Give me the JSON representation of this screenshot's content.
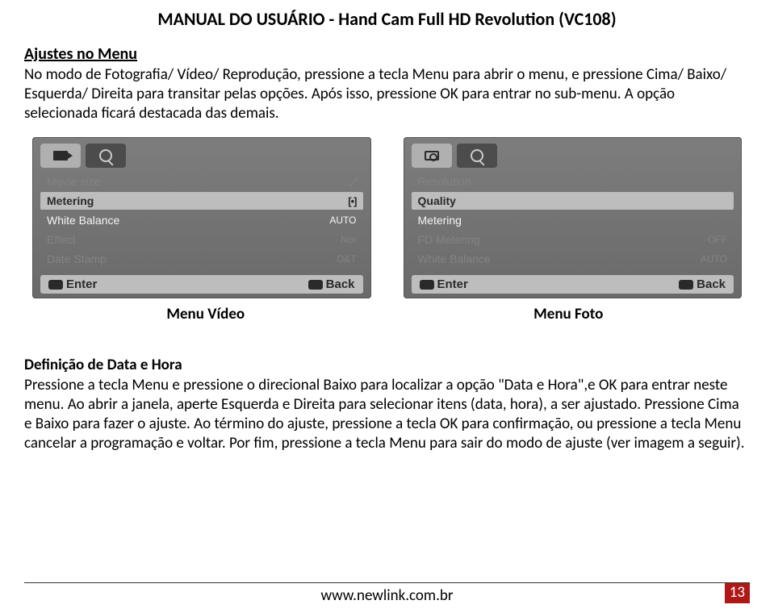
{
  "header": {
    "title": "MANUAL DO USUÁRIO -  Hand Cam Full HD Revolution (VC108)"
  },
  "section1": {
    "heading": "Ajustes no Menu",
    "body": "No modo de Fotografia/ Vídeo/ Reprodução, pressione a tecla Menu para abrir o menu, e pressione Cima/ Baixo/ Esquerda/ Direita para transitar pelas opções. Após isso, pressione OK para entrar no sub-menu. A opção selecionada ficará destacada das demais."
  },
  "screenshots": {
    "video": {
      "items": [
        {
          "label": "Movie size",
          "value": "",
          "state": "dimmed",
          "valueIcon": "expand"
        },
        {
          "label": "Metering",
          "value": "",
          "state": "highlight",
          "valueIcon": "meter"
        },
        {
          "label": "White Balance",
          "value": "AUTO",
          "state": "white"
        },
        {
          "label": "Effect",
          "value": "Nor",
          "state": "dimmed"
        },
        {
          "label": "Date Stamp",
          "value": "D&T",
          "state": "dimmed"
        }
      ],
      "footer": {
        "enter": "Enter",
        "back": "Back"
      },
      "caption": "Menu Vídeo"
    },
    "photo": {
      "items": [
        {
          "label": "Resolution",
          "value": "",
          "state": "dimmed"
        },
        {
          "label": "Quality",
          "value": "",
          "state": "highlight"
        },
        {
          "label": "Metering",
          "value": "",
          "state": "white"
        },
        {
          "label": "FD Metering",
          "value": "OFF",
          "state": "dimmed"
        },
        {
          "label": "White Balance",
          "value": "AUTO",
          "state": "dimmed"
        }
      ],
      "footer": {
        "enter": "Enter",
        "back": "Back"
      },
      "caption": "Menu Foto"
    }
  },
  "section2": {
    "heading": "Definição de Data e Hora",
    "body": "Pressione a tecla Menu e pressione o direcional Baixo para localizar a opção \"Data e Hora\",e OK para entrar neste menu. Ao abrir a janela, aperte Esquerda e Direita para selecionar itens (data, hora), a ser ajustado. Pressione Cima e Baixo para fazer o ajuste. Ao término do ajuste, pressione a tecla OK para confirmação, ou pressione a tecla Menu cancelar a programação e voltar. Por fim, pressione a tecla Menu para sair do modo de ajuste (ver imagem a seguir)."
  },
  "footer": {
    "url": "www.newlink.com.br",
    "page": "13"
  }
}
